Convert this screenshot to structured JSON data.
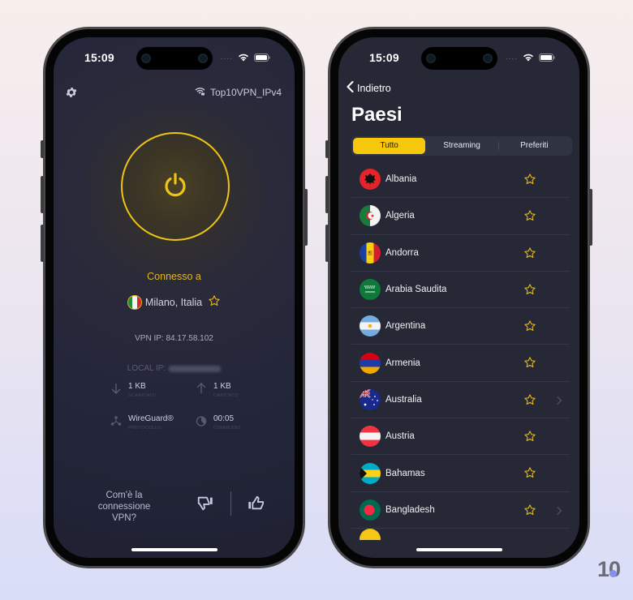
{
  "left_phone": {
    "status_bar": {
      "time": "15:09",
      "signal": "....",
      "wifi_icon": "wifi-icon",
      "battery_icon": "battery-icon"
    },
    "header": {
      "settings_icon": "gear-icon",
      "network_icon": "wifi-lock-icon",
      "network_name": "Top10VPN_IPv4"
    },
    "power_button": {
      "icon": "power-icon",
      "state": "connected"
    },
    "connection": {
      "label": "Connesso a",
      "location": "Milano, Italia",
      "flag": "italy-flag",
      "favorite_icon": "star-icon",
      "vpn_ip": "VPN IP: 84.17.58.102",
      "local_ip_label": "LOCAL IP:"
    },
    "stats": {
      "download": {
        "value": "1 KB",
        "label": "SCARICATO",
        "icon": "arrow-down-icon"
      },
      "upload": {
        "value": "1 KB",
        "label": "CARICATO",
        "icon": "arrow-up-icon"
      },
      "protocol": {
        "value": "WireGuard®",
        "label": "PROTOCOLLO",
        "icon": "protocol-icon"
      },
      "duration": {
        "value": "00:05",
        "label": "CONNESSO",
        "icon": "timer-icon"
      }
    },
    "feedback": {
      "question": "Com'è la connessione VPN?",
      "down_icon": "thumbs-down-icon",
      "up_icon": "thumbs-up-icon"
    }
  },
  "right_phone": {
    "status_bar": {
      "time": "15:09",
      "signal": "....",
      "wifi_icon": "wifi-icon",
      "battery_icon": "battery-icon"
    },
    "nav": {
      "back_label": "Indietro",
      "title": "Paesi"
    },
    "tabs": [
      {
        "label": "Tutto",
        "active": true
      },
      {
        "label": "Streaming",
        "active": false
      },
      {
        "label": "Preferiti",
        "active": false
      }
    ],
    "countries": [
      {
        "name": "Albania",
        "flag": "albania-flag",
        "favorite": false,
        "has_chevron": false
      },
      {
        "name": "Algeria",
        "flag": "algeria-flag",
        "favorite": false,
        "has_chevron": false
      },
      {
        "name": "Andorra",
        "flag": "andorra-flag",
        "favorite": false,
        "has_chevron": false
      },
      {
        "name": "Arabia Saudita",
        "flag": "saudi-arabia-flag",
        "favorite": false,
        "has_chevron": false
      },
      {
        "name": "Argentina",
        "flag": "argentina-flag",
        "favorite": false,
        "has_chevron": false
      },
      {
        "name": "Armenia",
        "flag": "armenia-flag",
        "favorite": false,
        "has_chevron": false
      },
      {
        "name": "Australia",
        "flag": "australia-flag",
        "favorite": false,
        "has_chevron": true
      },
      {
        "name": "Austria",
        "flag": "austria-flag",
        "favorite": false,
        "has_chevron": false
      },
      {
        "name": "Bahamas",
        "flag": "bahamas-flag",
        "favorite": false,
        "has_chevron": false
      },
      {
        "name": "Bangladesh",
        "flag": "bangladesh-flag",
        "favorite": false,
        "has_chevron": true
      }
    ]
  },
  "watermark": {
    "text": "10"
  },
  "colors": {
    "accent": "#f7c70c",
    "ring": "#f0c413",
    "star": "#e2b41b",
    "screen_bg": "#262835"
  }
}
